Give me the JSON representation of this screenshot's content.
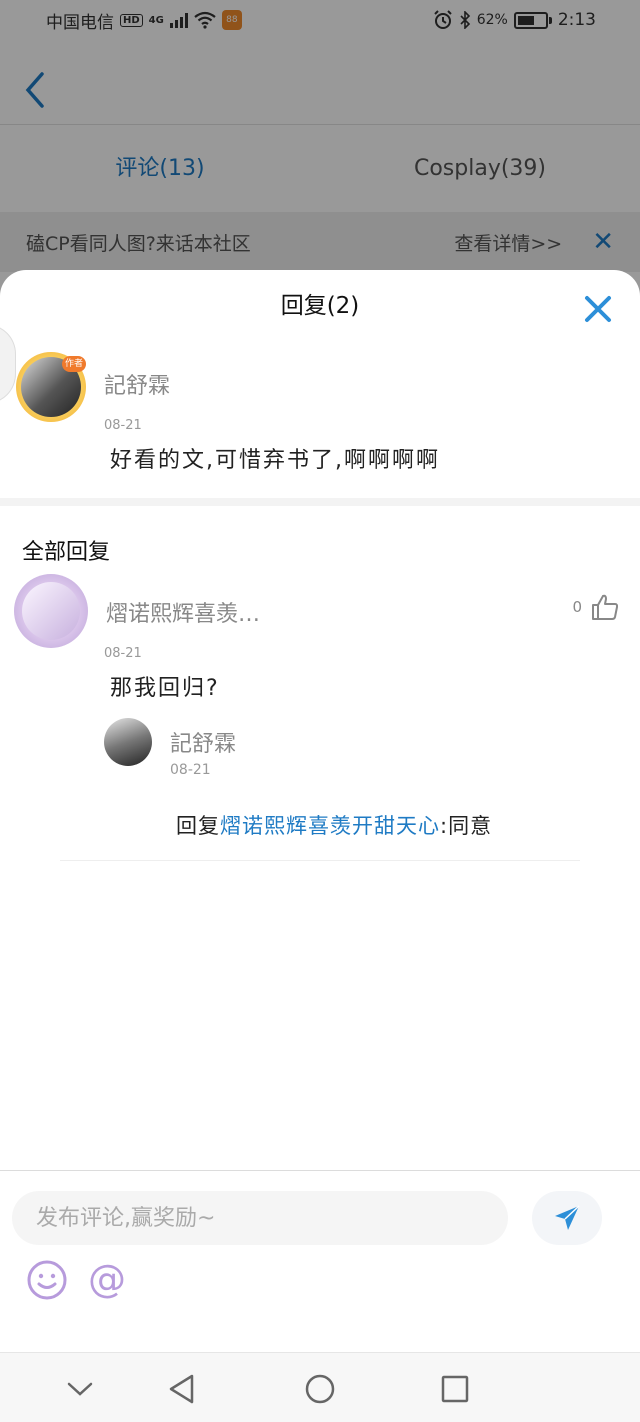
{
  "status_bar": {
    "carrier": "中国电信",
    "network_hd": "HD",
    "network_type": "4G",
    "battery": "62%",
    "battery_level": 0.62,
    "time": "2:13"
  },
  "header": {
    "tabs": [
      {
        "label": "评论(13)",
        "active": true
      },
      {
        "label": "Cosplay(39)",
        "active": false
      }
    ]
  },
  "banner": {
    "title": "磕CP看同人图?来话本社区",
    "link": "查看详情>>"
  },
  "sheet": {
    "title": "回复(2)",
    "main_comment": {
      "author": "記舒霖",
      "badge": "作者",
      "date": "08-21",
      "text": "好看的文,可惜弃书了,啊啊啊啊"
    },
    "all_replies_title": "全部回复",
    "replies": [
      {
        "author": "熠诺熙辉喜羡…",
        "date": "08-21",
        "likes": "0",
        "text": "那我回归?",
        "sub_reply": {
          "author": "記舒霖",
          "date": "08-21",
          "prefix": "回复",
          "target": "熠诺熙辉喜羡开甜天心",
          "text": ":同意"
        }
      }
    ]
  },
  "composer": {
    "placeholder": "发布评论,赢奖励~",
    "at_label": "@"
  },
  "colors": {
    "accent": "#1f7bc4",
    "close": "#2d8fd8",
    "secondary_text": "#888888"
  }
}
